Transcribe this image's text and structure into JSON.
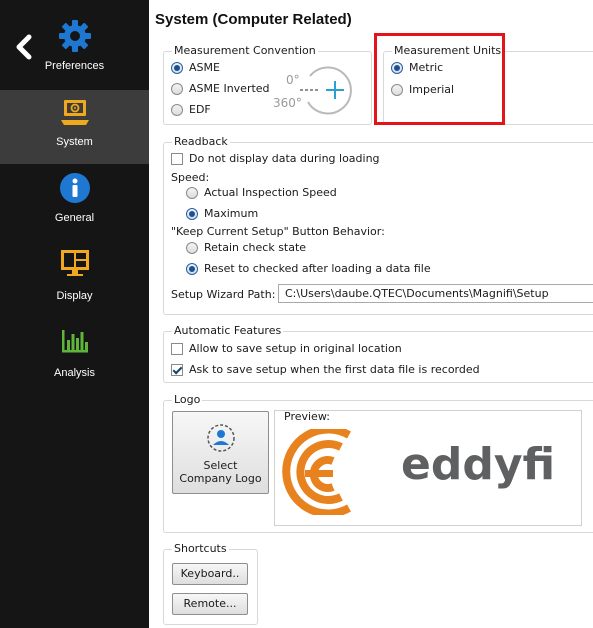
{
  "sidebar": {
    "items": [
      {
        "label": "Preferences",
        "icon": "gear-icon"
      },
      {
        "label": "System",
        "icon": "system-icon"
      },
      {
        "label": "General",
        "icon": "info-icon"
      },
      {
        "label": "Display",
        "icon": "display-icon"
      },
      {
        "label": "Analysis",
        "icon": "analysis-chart-icon"
      }
    ],
    "active": "System"
  },
  "page": {
    "title": "System (Computer Related)"
  },
  "measurement_convention": {
    "legend": "Measurement Convention",
    "options": [
      "ASME",
      "ASME Inverted",
      "EDF"
    ],
    "selected": "ASME",
    "diagram": {
      "top_label": "0°",
      "bottom_label": "360°"
    }
  },
  "measurement_units": {
    "legend": "Measurement Units",
    "options": [
      "Metric",
      "Imperial"
    ],
    "selected": "Metric"
  },
  "readback": {
    "legend": "Readback",
    "no_display_label": "Do not display data during loading",
    "no_display_checked": false,
    "speed_label": "Speed:",
    "speed_options": [
      "Actual Inspection Speed",
      "Maximum"
    ],
    "speed_selected": "Maximum",
    "keep_setup_label": "\"Keep Current Setup\" Button Behavior:",
    "keep_setup_options": [
      "Retain check state",
      "Reset to checked after loading a data file"
    ],
    "keep_setup_selected": "Reset to checked after loading a data file",
    "wizard_path_label": "Setup Wizard Path:",
    "wizard_path_value": "C:\\Users\\daube.QTEC\\Documents\\Magnifi\\Setup"
  },
  "automatic_features": {
    "legend": "Automatic Features",
    "allow_save_label": "Allow to save setup in original location",
    "allow_save_checked": false,
    "ask_save_label": "Ask to save setup when the first data file is recorded",
    "ask_save_checked": true
  },
  "logo": {
    "legend": "Logo",
    "select_button_line1": "Select",
    "select_button_line2": "Company Logo",
    "preview_label": "Preview:",
    "logo_text": "eddyfi",
    "logo_color": "#e8821e",
    "logo_text_color": "#5f6062"
  },
  "shortcuts": {
    "legend": "Shortcuts",
    "keyboard_label": "Keyboard..",
    "remote_label": "Remote..."
  },
  "colors": {
    "sidebar_bg": "#151515",
    "sidebar_active": "#3c3c3c",
    "accent_orange": "#f0a81e",
    "info_blue": "#1e78d2",
    "analysis_green": "#5fb53a",
    "highlight_red": "#e4141b",
    "diagram_blue": "#2a9fd6"
  }
}
